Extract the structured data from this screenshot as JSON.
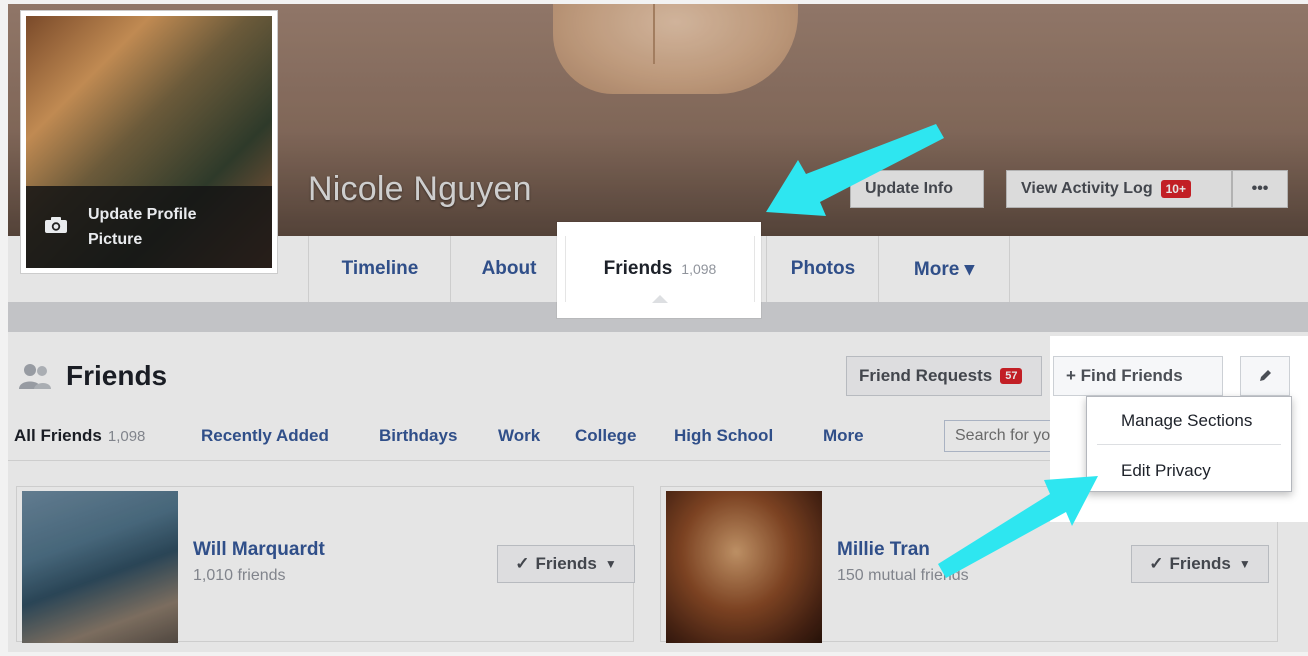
{
  "profile": {
    "name": "Nicole Nguyen",
    "update_picture_line1": "Update Profile",
    "update_picture_line2": "Picture"
  },
  "cover_actions": {
    "update_info": "Update Info",
    "view_activity_log": "View Activity Log",
    "activity_badge": "10+",
    "more": "•••"
  },
  "nav": {
    "tabs": [
      {
        "label": "Timeline"
      },
      {
        "label": "About"
      },
      {
        "label": "Friends",
        "count": "1,098"
      },
      {
        "label": "Photos"
      },
      {
        "label": "More ▾"
      }
    ]
  },
  "friends_section": {
    "heading": "Friends",
    "friend_requests": "Friend Requests",
    "friend_requests_badge": "57",
    "find_friends": "+ Find Friends",
    "filters": [
      {
        "label": "All Friends",
        "count": "1,098"
      },
      {
        "label": "Recently Added"
      },
      {
        "label": "Birthdays"
      },
      {
        "label": "Work"
      },
      {
        "label": "College"
      },
      {
        "label": "High School"
      },
      {
        "label": "More"
      }
    ],
    "search_placeholder": "Search for your"
  },
  "dropdown": {
    "items": [
      "Manage Sections",
      "Edit Privacy"
    ]
  },
  "friends": [
    {
      "name": "Will Marquardt",
      "subtitle": "1,010 friends",
      "button": "Friends"
    },
    {
      "name": "Millie Tran",
      "subtitle": "150 mutual friends",
      "button": "Friends"
    }
  ],
  "colors": {
    "link_blue": "#365899",
    "badge_red": "#d8232a",
    "arrow_cyan": "#2ee6f0"
  },
  "icons": [
    "camera-icon",
    "friends-group-icon",
    "pencil-icon",
    "checkmark-icon",
    "caret-down-icon",
    "arrow-annotation-icon"
  ]
}
